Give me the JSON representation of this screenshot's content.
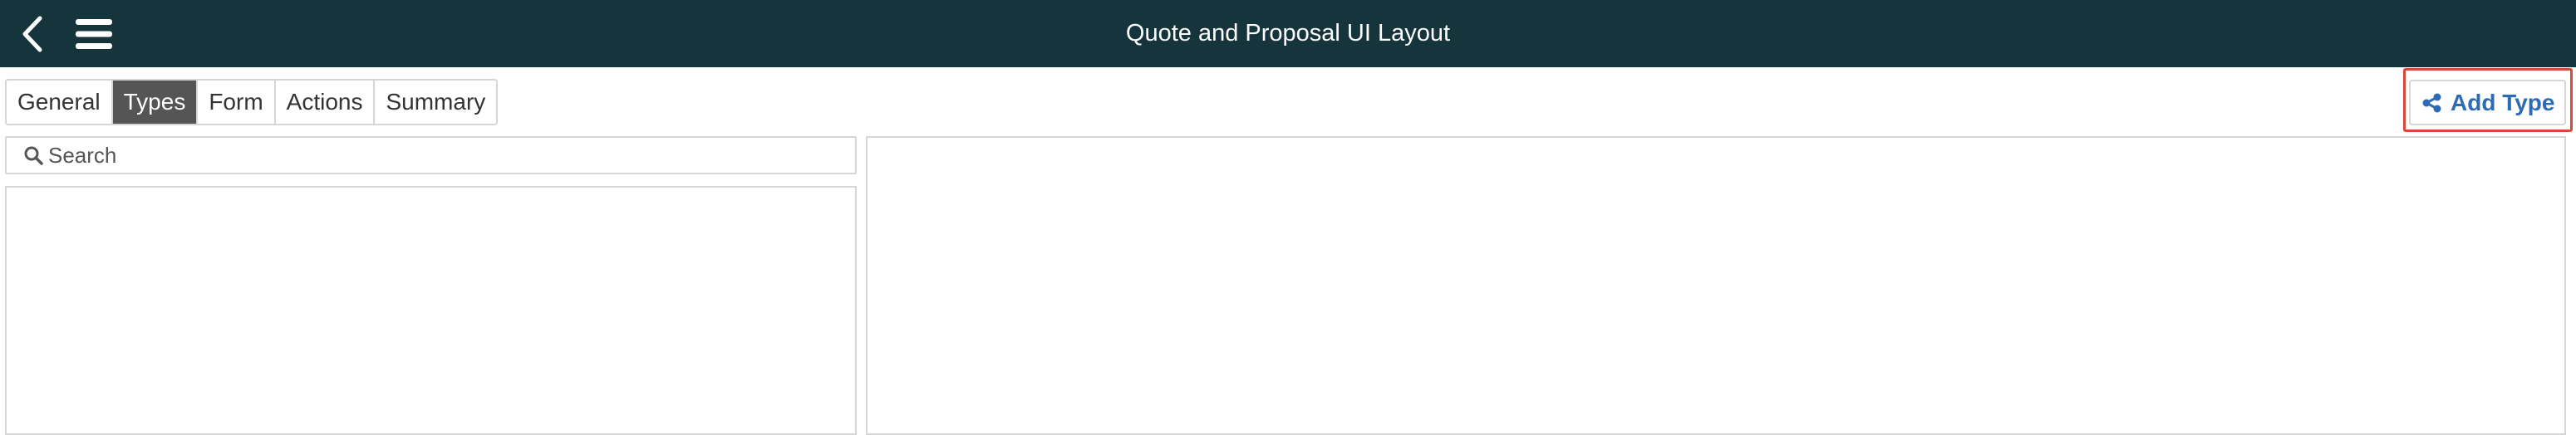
{
  "header": {
    "title": "Quote and Proposal UI Layout",
    "back_icon": "chevron-left-icon",
    "menu_icon": "hamburger-menu-icon"
  },
  "tabs": [
    {
      "label": "General",
      "active": false
    },
    {
      "label": "Types",
      "active": true
    },
    {
      "label": "Form",
      "active": false
    },
    {
      "label": "Actions",
      "active": false
    },
    {
      "label": "Summary",
      "active": false
    }
  ],
  "toolbar": {
    "add_type_label": "Add Type",
    "add_type_icon": "share-nodes-icon"
  },
  "search": {
    "placeholder": "Search",
    "value": "",
    "icon": "search-icon"
  },
  "colors": {
    "header_bg": "#15343c",
    "active_tab_bg": "#555555",
    "accent_blue": "#2e6bb5",
    "highlight_red": "#d9493a"
  }
}
